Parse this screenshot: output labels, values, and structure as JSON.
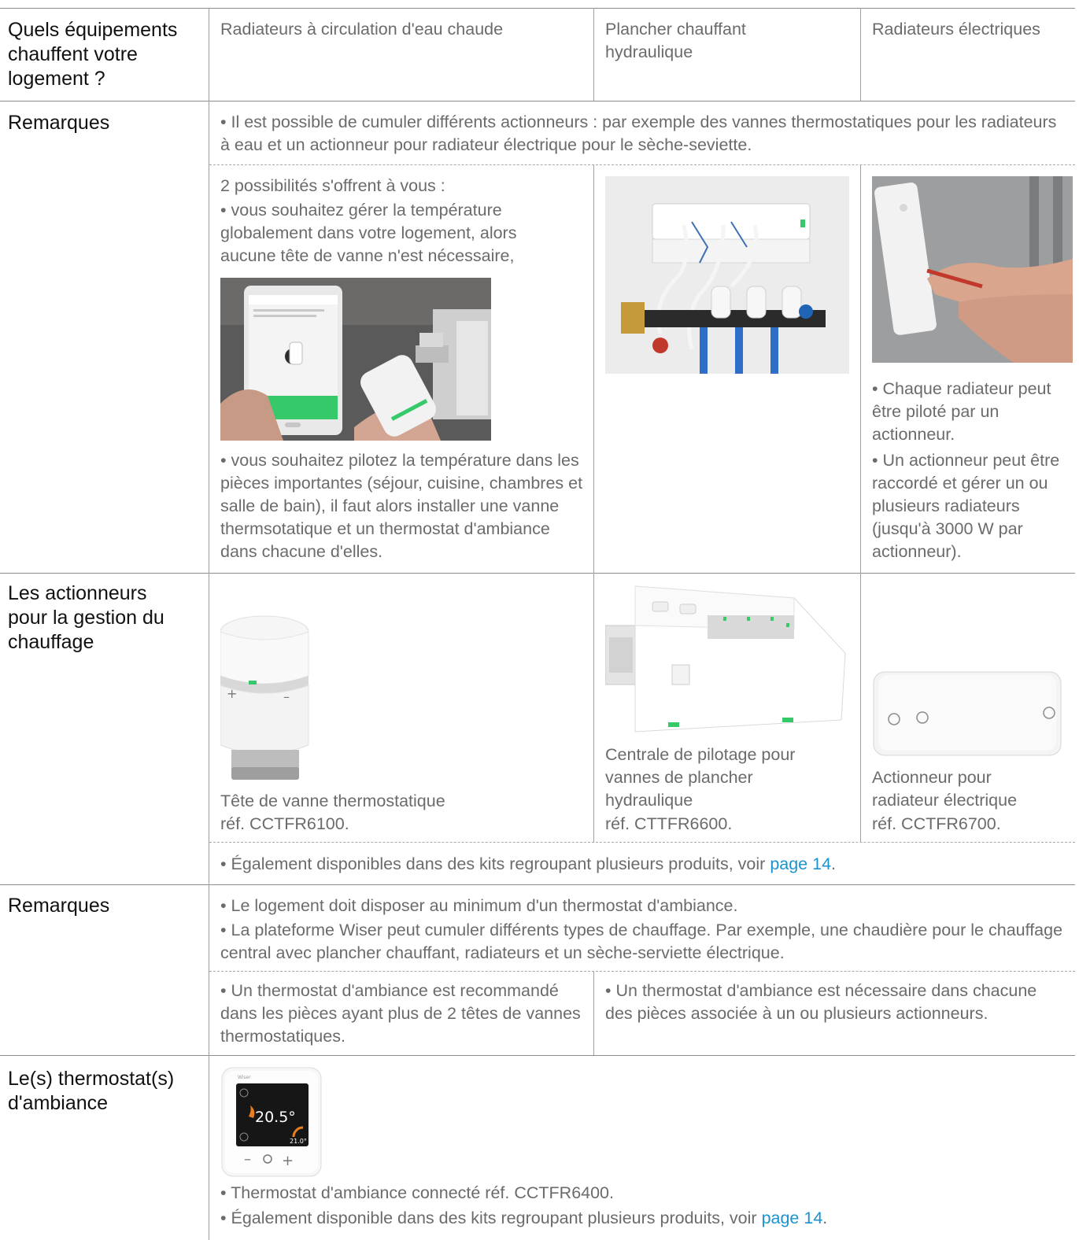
{
  "header": {
    "question": "Quels équipements chauffent votre logement ?",
    "col1": "Radiateurs à circulation d'eau chaude",
    "col2": "Plancher chauffant hydraulique",
    "col3": "Radiateurs électriques"
  },
  "remarks1": {
    "label": "Remarques",
    "general": "• Il est possible de cumuler différents actionneurs : par exemple des vannes thermostatiques pour les radiateurs à eau et un actionneur pour radiateur électrique pour le sèche-seviette.",
    "col1_intro": "2 possibilités s'offrent à vous :",
    "col1_option1": "• vous souhaitez gérer la température globalement dans votre logement, alors aucune tête de vanne n'est nécessaire,",
    "col1_option2": "• vous souhaitez pilotez la température dans les pièces importantes (séjour, cuisine, chambres et salle de bain), il faut alors installer une vanne thermsotatique et un thermostat d'ambiance dans chacune d'elles.",
    "col3_note1": "• Chaque radiateur peut être piloté par un actionneur.",
    "col3_note2": "• Un actionneur peut être raccordé et gérer un ou plusieurs radiateurs (jusqu'à 3000 W par actionneur)."
  },
  "actuators": {
    "label": "Les actionneurs pour la gestion du chauffage",
    "col1_caption": "Tête de vanne thermostatique",
    "col1_ref": "réf. CCTFR6100.",
    "col2_caption": "Centrale de pilotage pour vannes de plancher hydraulique",
    "col2_ref": "réf. CTTFR6600.",
    "col3_caption": "Actionneur pour radiateur électrique",
    "col3_ref": "réf. CCTFR6700.",
    "kits_text": "• Également disponibles dans des kits regroupant plusieurs produits, voir ",
    "kits_link": "page 14",
    "kits_end": "."
  },
  "remarks2": {
    "label": "Remarques",
    "note1": "• Le logement doit disposer au minimum d'un thermostat d'ambiance.",
    "note2": "• La plateforme Wiser peut cumuler différents types de chauffage. Par exemple, une chaudière pour le chauffage central avec plancher chauffant, radiateurs et un sèche-serviette électrique.",
    "col1": "• Un thermostat d'ambiance est recommandé dans les pièces ayant plus de 2 têtes de vannes thermostatiques.",
    "col23": "• Un thermostat d'ambiance est nécessaire dans chacune des pièces associée à un ou plusieurs actionneurs."
  },
  "thermostat": {
    "label": "Le(s) thermostat(s) d'ambiance",
    "display_temp": "20.5°",
    "display_set": "21.0°",
    "brand": "Wiser",
    "ref_text": "• Thermostat d'ambiance connecté réf. CCTFR6400.",
    "kits_text": "• Également disponible dans des kits regroupant plusieurs produits, voir ",
    "kits_link": "page 14",
    "kits_end": "."
  },
  "colors": {
    "link": "#1a93d1",
    "label_text": "#111111",
    "body_text": "#6b6b6b",
    "rule": "#8c8c8c"
  }
}
